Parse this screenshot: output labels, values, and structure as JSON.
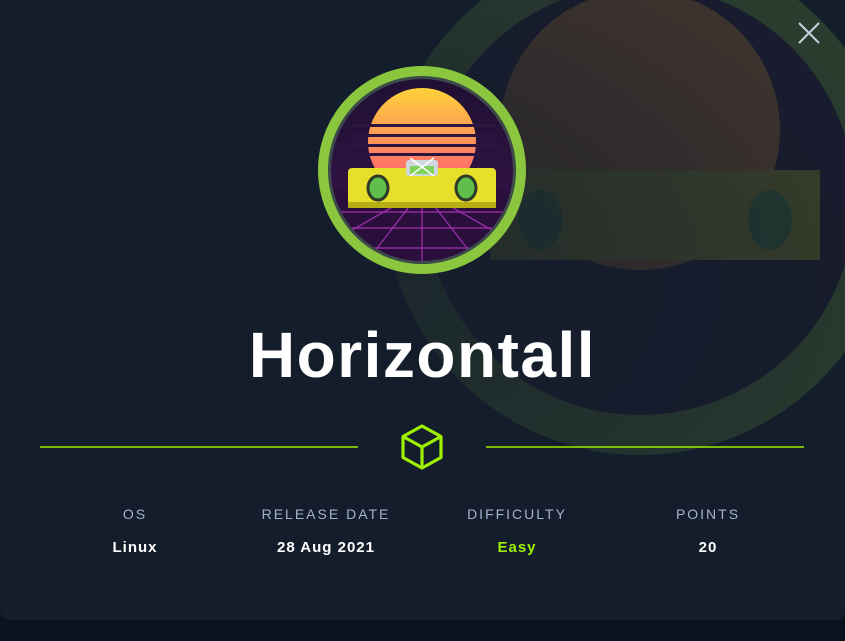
{
  "machine": {
    "name": "Horizontall",
    "avatar_icon": "spirit-level-sunset-avatar",
    "ring_color": "#8ac73e"
  },
  "stats": [
    {
      "label": "OS",
      "value": "Linux"
    },
    {
      "label": "RELEASE DATE",
      "value": "28 Aug 2021"
    },
    {
      "label": "DIFFICULTY",
      "value": "Easy",
      "value_color": "#9fef00"
    },
    {
      "label": "POINTS",
      "value": "20"
    }
  ],
  "icons": {
    "close": "close-icon",
    "divider": "cube-icon"
  },
  "colors": {
    "accent": "#9fef00",
    "background": "#141d2b",
    "label": "#a4b1cd"
  }
}
